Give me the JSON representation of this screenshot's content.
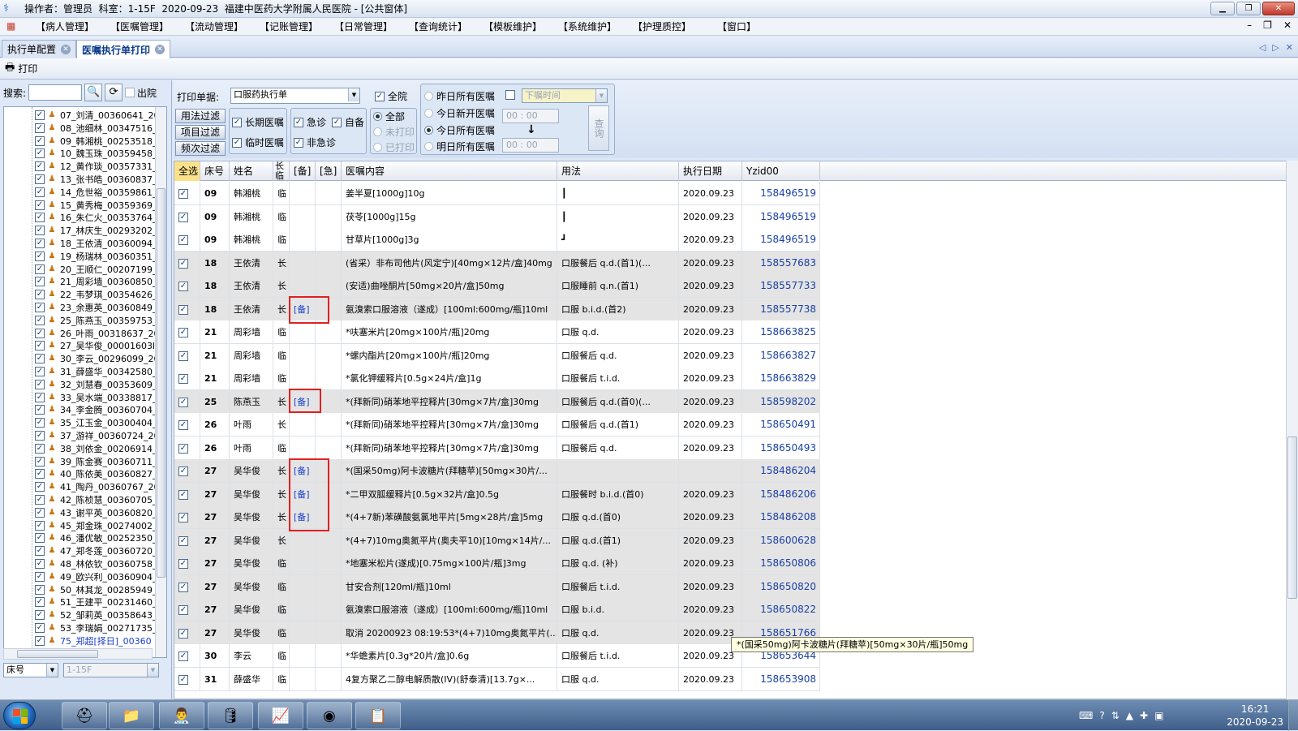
{
  "window": {
    "title": "操作者：管理员  科室：1-15F  2020-09-23  福建中医药大学附属人民医院 - [公共窗体]"
  },
  "menu": [
    "【病人管理】",
    "【医嘱管理】",
    "【流动管理】",
    "【记账管理】",
    "【日常管理】",
    "【查询统计】",
    "【模板维护】",
    "【系统维护】",
    "【护理质控】",
    "【窗口】"
  ],
  "tabs": [
    {
      "label": "执行单配置"
    },
    {
      "label": "医嘱执行单打印"
    }
  ],
  "toolbar": {
    "print": "打印"
  },
  "left": {
    "search_label": "搜索:",
    "discharged_label": "出院",
    "patients": [
      "07_刘清_00360641_20",
      "08_池细林_00347516_",
      "09_韩湘桃_00253518_",
      "10_魏玉珠_00359458_",
      "12_黄作琰_00357331_",
      "13_张书皓_00360837_",
      "14_危世裕_00359861_",
      "15_黄秀梅_00359369_",
      "16_朱仁火_00353764_",
      "17_林庆生_00293202_",
      "18_王依清_00360094_",
      "19_杨瑞林_00360351_",
      "20_王顺仁_00207199_",
      "21_周彩墙_00360850_",
      "22_韦梦琪_00354626_",
      "23_余惠英_00360849_",
      "25_陈燕玉_00359753_",
      "26_叶雨_00318637_20",
      "27_吴华俊_00001603l",
      "30_李云_00296099_20",
      "31_薛盛华_00342580_",
      "32_刘慧春_00353609_",
      "33_吴水端_00338817_",
      "34_李金腾_00360704_",
      "35_江玉金_00300404_",
      "37_游祥_00360724_20",
      "38_刘依金_00206914_",
      "39_陈金赛_00360711_",
      "40_陈依美_00360827_",
      "41_陶丹_00360767_20",
      "42_陈桢慧_00360705_",
      "43_谢平英_00360820_",
      "45_郑金珠_00274002_",
      "46_潘优敏_00252350_",
      "47_郑冬莲_00360720_",
      "48_林依钦_00360758_",
      "49_欧兴利_00360904_",
      "50_林其龙_00285949_",
      "51_王建平_00231460_",
      "52_邹莉英_00358643_",
      "53_李瑞娟_00271735_",
      "75_郑超[择日]_00360"
    ],
    "bed_combo": "床号",
    "ward_combo": "1-15F"
  },
  "filters": {
    "print_label": "打印单据:",
    "print_value": "口服药执行单",
    "all_hospital": "全院",
    "btn_usage": "用法过滤",
    "btn_item": "项目过滤",
    "btn_freq": "频次过滤",
    "long_term": "长期医嘱",
    "temporary": "临时医嘱",
    "urgent": "急诊",
    "self_prep": "自备",
    "non_urgent": "非急诊",
    "all": "全部",
    "not_printed": "未打印",
    "printed": "已打印",
    "yesterday_all": "昨日所有医嘱",
    "today_new": "今日新开医嘱",
    "today_all": "今日所有医嘱",
    "tomorrow_all": "明日所有医嘱",
    "order_time": "下嘱时间",
    "time1": "00 : 00",
    "time2": "00 : 00",
    "query": "查询"
  },
  "grid": {
    "headers": [
      "全选",
      "床号",
      "姓名",
      "长临",
      "[备]",
      "[急]",
      "医嘱内容",
      "用法",
      "执行日期",
      "Yzid00"
    ],
    "rows": [
      {
        "bed": "09",
        "name": "韩湘桃",
        "type": "临",
        "bei": "",
        "content": "姜半夏[1000g]10g",
        "usage": "┃",
        "date": "2020.09.23",
        "id": "158496519",
        "shade": "white"
      },
      {
        "bed": "09",
        "name": "韩湘桃",
        "type": "临",
        "bei": "",
        "content": "茯苓[1000g]15g",
        "usage": "┃",
        "date": "2020.09.23",
        "id": "158496519",
        "shade": "white"
      },
      {
        "bed": "09",
        "name": "韩湘桃",
        "type": "临",
        "bei": "",
        "content": "甘草片[1000g]3g",
        "usage": "┛",
        "date": "2020.09.23",
        "id": "158496519",
        "shade": "white"
      },
      {
        "bed": "18",
        "name": "王依清",
        "type": "长",
        "bei": "",
        "content": "(省采）非布司他片(风定宁)[40mg×12片/盒]40mg",
        "usage": "口服餐后 q.d.(首1)(...",
        "date": "2020.09.23",
        "id": "158557683",
        "shade": "gray"
      },
      {
        "bed": "18",
        "name": "王依清",
        "type": "长",
        "bei": "",
        "content": "(安适)曲唑酮片[50mg×20片/盒]50mg",
        "usage": "口服睡前 q.n.(首1)",
        "date": "2020.09.23",
        "id": "158557733",
        "shade": "gray"
      },
      {
        "bed": "18",
        "name": "王依清",
        "type": "长",
        "bei": "[备]",
        "content": "氨溴索口服溶液（遂成）[100ml:600mg/瓶]10ml",
        "usage": "口服 b.i.d.(首2)",
        "date": "2020.09.23",
        "id": "158557738",
        "shade": "gray"
      },
      {
        "bed": "21",
        "name": "周彩墙",
        "type": "临",
        "bei": "",
        "content": "*呋塞米片[20mg×100片/瓶]20mg",
        "usage": "口服 q.d.",
        "date": "2020.09.23",
        "id": "158663825",
        "shade": "white"
      },
      {
        "bed": "21",
        "name": "周彩墙",
        "type": "临",
        "bei": "",
        "content": "*螺内酯片[20mg×100片/瓶]20mg",
        "usage": "口服餐后 q.d.",
        "date": "2020.09.23",
        "id": "158663827",
        "shade": "white"
      },
      {
        "bed": "21",
        "name": "周彩墙",
        "type": "临",
        "bei": "",
        "content": "*氯化钾缓释片[0.5g×24片/盒]1g",
        "usage": "口服餐后 t.i.d.",
        "date": "2020.09.23",
        "id": "158663829",
        "shade": "white"
      },
      {
        "bed": "25",
        "name": "陈燕玉",
        "type": "长",
        "bei": "[备]",
        "content": "*(拜新同)硝苯地平控释片[30mg×7片/盒]30mg",
        "usage": "口服餐后 q.d.(首0)(...",
        "date": "2020.09.23",
        "id": "158598202",
        "shade": "gray"
      },
      {
        "bed": "26",
        "name": "叶雨",
        "type": "长",
        "bei": "",
        "content": "*(拜新同)硝苯地平控释片[30mg×7片/盒]30mg",
        "usage": "口服餐后 q.d.(首1)",
        "date": "2020.09.23",
        "id": "158650491",
        "shade": "white"
      },
      {
        "bed": "26",
        "name": "叶雨",
        "type": "临",
        "bei": "",
        "content": "*(拜新同)硝苯地平控释片[30mg×7片/盒]30mg",
        "usage": "口服餐后 q.d.",
        "date": "2020.09.23",
        "id": "158650493",
        "shade": "white"
      },
      {
        "bed": "27",
        "name": "吴华俊",
        "type": "长",
        "bei": "[备]",
        "content": "*(国采50mg)阿卡波糖片(拜糖苹)[50mg×30片/...",
        "usage": "",
        "date": "",
        "id": "158486204",
        "shade": "gray"
      },
      {
        "bed": "27",
        "name": "吴华俊",
        "type": "长",
        "bei": "[备]",
        "content": "*二甲双胍缓释片[0.5g×32片/盒]0.5g",
        "usage": "口服餐时 b.i.d.(首0)",
        "date": "2020.09.23",
        "id": "158486206",
        "shade": "gray"
      },
      {
        "bed": "27",
        "name": "吴华俊",
        "type": "长",
        "bei": "[备]",
        "content": "*(4+7新)苯磺酸氨氯地平片[5mg×28片/盒]5mg",
        "usage": "口服 q.d.(首0)",
        "date": "2020.09.23",
        "id": "158486208",
        "shade": "gray"
      },
      {
        "bed": "27",
        "name": "吴华俊",
        "type": "长",
        "bei": "",
        "content": "*(4+7)10mg奥氮平片(奥夫平10)[10mg×14片/...",
        "usage": "口服 q.d.(首1)",
        "date": "2020.09.23",
        "id": "158600628",
        "shade": "gray"
      },
      {
        "bed": "27",
        "name": "吴华俊",
        "type": "临",
        "bei": "",
        "content": "*地塞米松片(遂成)[0.75mg×100片/瓶]3mg",
        "usage": "口服 q.d. (补)",
        "date": "2020.09.23",
        "id": "158650806",
        "shade": "gray"
      },
      {
        "bed": "27",
        "name": "吴华俊",
        "type": "临",
        "bei": "",
        "content": "甘安合剂[120ml/瓶]10ml",
        "usage": "口服餐后 t.i.d.",
        "date": "2020.09.23",
        "id": "158650820",
        "shade": "gray"
      },
      {
        "bed": "27",
        "name": "吴华俊",
        "type": "临",
        "bei": "",
        "content": "氨溴索口服溶液（遂成）[100ml:600mg/瓶]10ml",
        "usage": "口服 b.i.d.",
        "date": "2020.09.23",
        "id": "158650822",
        "shade": "gray"
      },
      {
        "bed": "27",
        "name": "吴华俊",
        "type": "临",
        "bei": "",
        "content": "取消 20200923 08:19:53*(4+7)10mg奥氮平片(...",
        "usage": "口服 q.d.",
        "date": "2020.09.23",
        "id": "158651766",
        "shade": "gray"
      },
      {
        "bed": "30",
        "name": "李云",
        "type": "临",
        "bei": "",
        "content": "*华蟾素片[0.3g*20片/盒]0.6g",
        "usage": "口服餐后 t.i.d.",
        "date": "2020.09.23",
        "id": "158653644",
        "shade": "white"
      },
      {
        "bed": "31",
        "name": "薛盛华",
        "type": "临",
        "bei": "",
        "content": "4复方聚乙二醇电解质散(IV)(舒泰清)[13.7g×...",
        "usage": "口服 q.d.",
        "date": "2020.09.23",
        "id": "158653908",
        "shade": "white"
      }
    ]
  },
  "tooltip": "*(国采50mg)阿卡波糖片(拜糖苹)[50mg×30片/瓶]50mg",
  "taskbar": {
    "time": "16:21",
    "date": "2020-09-23"
  },
  "colors": {
    "accent": "#1a3fa6",
    "highlight_box": "#e02020",
    "header_select": "#fbe18a"
  }
}
